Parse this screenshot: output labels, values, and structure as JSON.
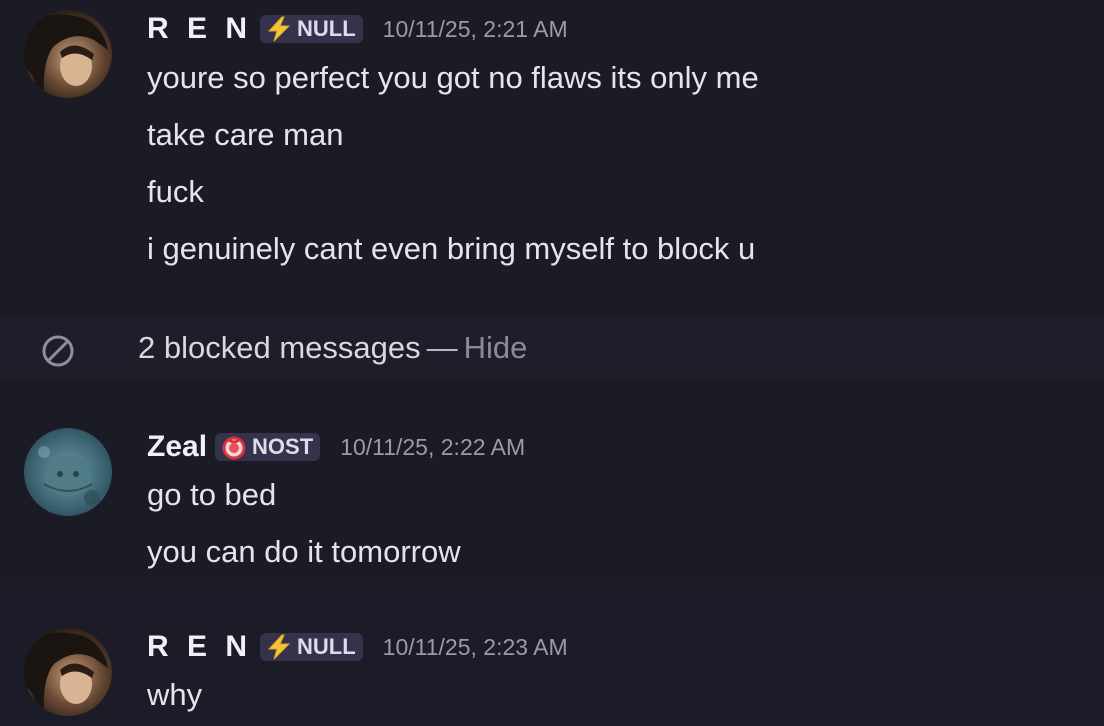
{
  "messages": [
    {
      "author": "R E N",
      "tag": "NULL",
      "tag_icon": "lightning-icon",
      "timestamp": "10/11/25, 2:21 AM",
      "lines": [
        "youre so perfect you got no flaws its only me",
        "take care man",
        "fuck",
        "i genuinely cant even bring myself to block u"
      ]
    },
    {
      "author": "Zeal",
      "tag": "NOST",
      "tag_icon": "red-ring-icon",
      "timestamp": "10/11/25, 2:22 AM",
      "lines": [
        "go to bed",
        "you can do it tomorrow"
      ]
    },
    {
      "author": "R E N",
      "tag": "NULL",
      "tag_icon": "lightning-icon",
      "timestamp": "10/11/25, 2:23 AM",
      "lines": [
        "why"
      ]
    }
  ],
  "blocked": {
    "icon": "blocked-icon",
    "text": "2 blocked messages",
    "separator": "—",
    "action": "Hide"
  },
  "colors": {
    "background": "#1a1a24",
    "tag_background": "#35334c",
    "timestamp": "#9a9aaa",
    "hide_link": "#8a8a9c"
  }
}
